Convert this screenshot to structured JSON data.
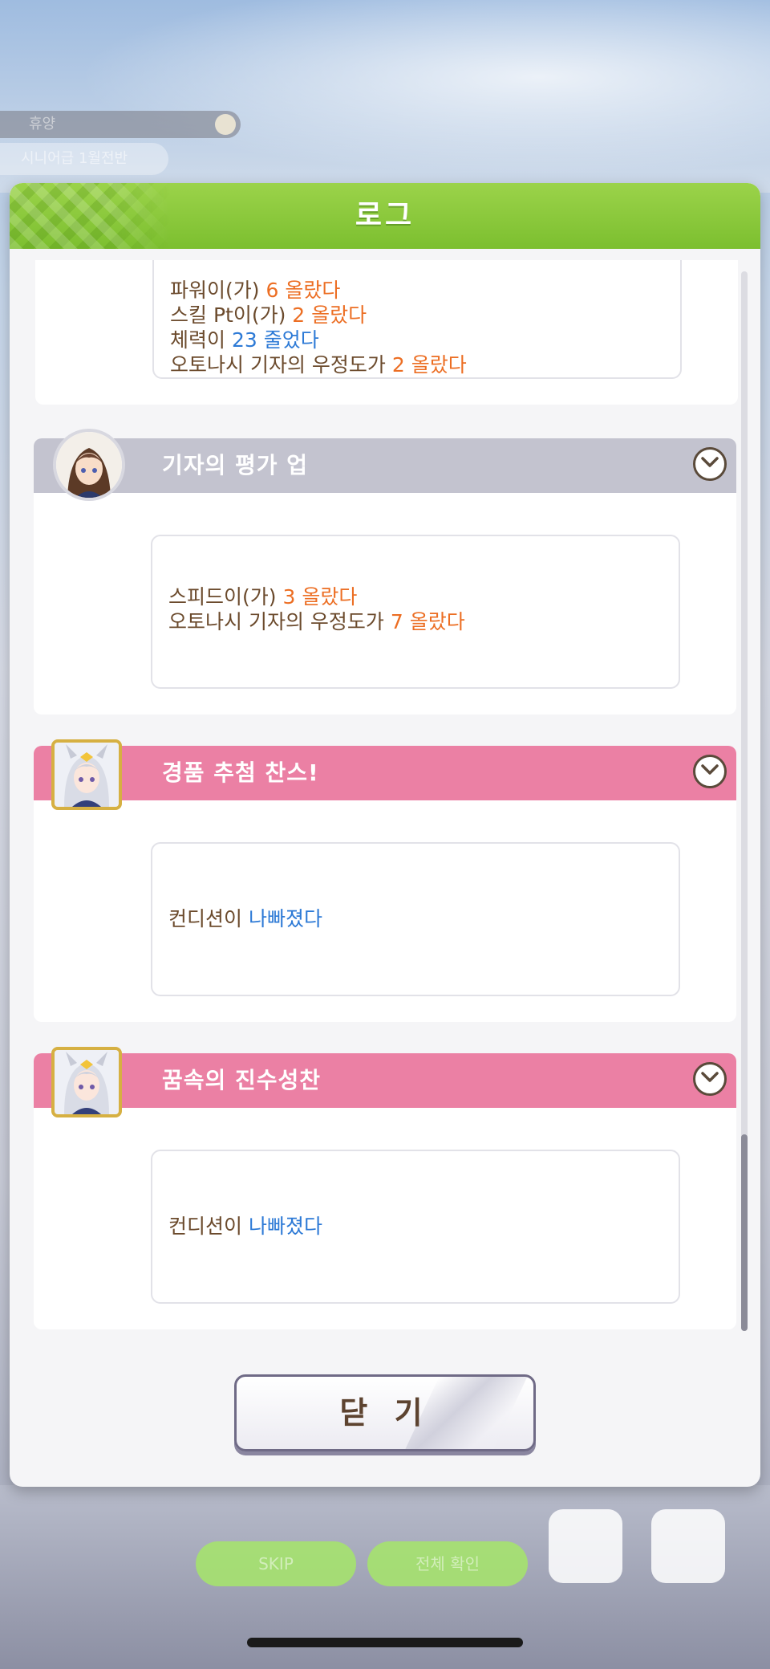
{
  "dialog": {
    "title": "로그",
    "close_label": "닫 기"
  },
  "entries": [
    {
      "header": "",
      "lines": [
        [
          {
            "t": "파워이(가) ",
            "c": "text"
          },
          {
            "t": "6 올랐다",
            "c": "orange"
          }
        ],
        [
          {
            "t": "스킬 Pt이(가) ",
            "c": "text"
          },
          {
            "t": "2 올랐다",
            "c": "orange"
          }
        ],
        [
          {
            "t": "체력이 ",
            "c": "text"
          },
          {
            "t": "23 줄었다",
            "c": "blue"
          }
        ],
        [
          {
            "t": "오토나시 기자의 우정도가 ",
            "c": "text"
          },
          {
            "t": "2 올랐다",
            "c": "orange"
          }
        ]
      ]
    },
    {
      "header": "기자의 평가 업",
      "header_color": "#c3c3cf",
      "avatar": "reporter-avatar",
      "lines": [
        [
          {
            "t": "스피드이(가) ",
            "c": "text"
          },
          {
            "t": "3 올랐다",
            "c": "orange"
          }
        ],
        [
          {
            "t": "오토나시 기자의 우정도가 ",
            "c": "text"
          },
          {
            "t": "7 올랐다",
            "c": "orange"
          }
        ]
      ]
    },
    {
      "header": "경품 추첨 찬스!",
      "header_color": "#eb80a4",
      "avatar": "horse-girl-avatar",
      "lines": [
        [
          {
            "t": "컨디션이 ",
            "c": "text"
          },
          {
            "t": "나빠졌다",
            "c": "blue"
          }
        ]
      ]
    },
    {
      "header": "꿈속의 진수성찬",
      "header_color": "#eb80a4",
      "avatar": "horse-girl-avatar",
      "lines": [
        [
          {
            "t": "컨디션이 ",
            "c": "text"
          },
          {
            "t": "나빠졌다",
            "c": "blue"
          }
        ]
      ]
    }
  ],
  "background": {
    "tag1": "휴양",
    "tag2": "시니어급 1월전반",
    "pill1": "SKIP",
    "pill2": "전체 확인"
  },
  "colors": {
    "header_green": "#8cc83c",
    "text_brown": "#6b4a2c",
    "increase_orange": "#ec6e23",
    "decrease_blue": "#2d7ad6"
  }
}
